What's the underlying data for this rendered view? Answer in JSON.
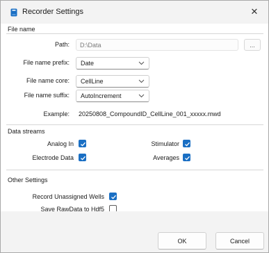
{
  "window": {
    "title": "Recorder Settings",
    "close_glyph": "✕",
    "icon": "recorder-app-icon"
  },
  "file_name": {
    "group_title": "File name",
    "path": {
      "label": "Path:",
      "value": "D:\\Data",
      "browse_label": "..."
    },
    "prefix": {
      "label": "File name prefix:",
      "value": "Date"
    },
    "core": {
      "label": "File name core:",
      "value": "CellLine"
    },
    "suffix": {
      "label": "File name suffix:",
      "value": "AutoIncrement"
    },
    "example": {
      "label": "Example:",
      "value": "20250808_CompoundID_CellLine_001_xxxxx.mwd"
    }
  },
  "data_streams": {
    "group_title": "Data streams",
    "analog_in": {
      "label": "Analog In",
      "checked": true
    },
    "electrode_data": {
      "label": "Electrode Data",
      "checked": true
    },
    "stimulator": {
      "label": "Stimulator",
      "checked": true
    },
    "averages": {
      "label": "Averages",
      "checked": true
    }
  },
  "other_settings": {
    "group_title": "Other Settings",
    "record_unassigned": {
      "label": "Record Unassigned Wells",
      "checked": true
    },
    "save_rawdata": {
      "label": "Save RawData to Hdf5",
      "checked": false
    }
  },
  "buttons": {
    "ok_label": "OK",
    "cancel_label": "Cancel"
  },
  "colors": {
    "accent": "#1a6fc4",
    "title_bar": "#f3f3f3",
    "content_bg": "#ffffff"
  }
}
